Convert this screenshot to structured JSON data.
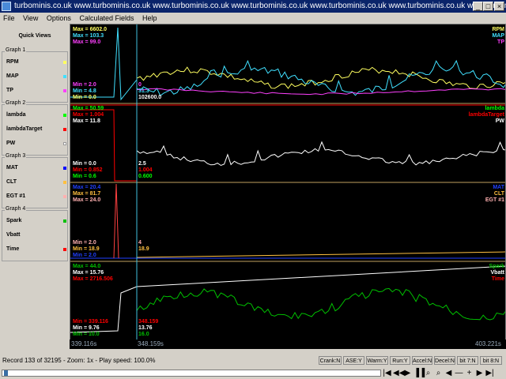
{
  "window": {
    "title": "turbominis.co.uk www.turbominis.co.uk www.turbominis.co.uk www.turbominis.co.uk www.turbominis.co.uk www.turbominis.co.uk www.turbominis.co.uk www.turbominis.co.uk",
    "minimize": "_",
    "maximize": "□",
    "close": "×"
  },
  "menu": [
    "File",
    "View",
    "Options",
    "Calculated Fields",
    "Help"
  ],
  "sidebar": {
    "heading": "Quick Views",
    "groups": [
      {
        "title": "Graph 1",
        "fields": [
          {
            "label": "RPM",
            "color": "#ffff60"
          },
          {
            "label": "MAP",
            "color": "#40e0ff"
          },
          {
            "label": "TP",
            "color": "#ff40ff"
          }
        ]
      },
      {
        "title": "Graph 2",
        "fields": [
          {
            "label": "lambda",
            "color": "#00ff00"
          },
          {
            "label": "lambdaTarget",
            "color": "#ff0000"
          },
          {
            "label": "PW",
            "color": "#ffffff"
          }
        ]
      },
      {
        "title": "Graph 3",
        "fields": [
          {
            "label": "MAT",
            "color": "#0000ff"
          },
          {
            "label": "CLT",
            "color": "#ffc040"
          },
          {
            "label": "EGT #1",
            "color": "#ffb0b0"
          }
        ]
      },
      {
        "title": "Graph 4",
        "fields": [
          {
            "label": "Spark",
            "color": "#00c000"
          },
          {
            "label": "Vbatt",
            "color": "#ffffff"
          },
          {
            "label": "Time",
            "color": "#ff0000"
          }
        ]
      }
    ]
  },
  "graphs": [
    {
      "max": [
        {
          "text": "Max = 6602.0",
          "color": "#ffff60"
        },
        {
          "text": "Max = 103.3",
          "color": "#40e0ff"
        },
        {
          "text": "Max = 99.0",
          "color": "#ff40ff"
        }
      ],
      "min": [
        {
          "text": "Min = 2.0",
          "color": "#ff40ff"
        },
        {
          "text": "Min = 4.8",
          "color": "#40e0ff"
        },
        {
          "text": "Min = 0.0",
          "color": "#ffff60"
        }
      ],
      "cursor": [
        {
          "text": "0",
          "color": "#ff40ff"
        },
        {
          "text": "31.3",
          "color": "#40e0ff"
        },
        {
          "text": "102600.0",
          "color": "#ffffff"
        }
      ],
      "legend": [
        {
          "text": "RPM",
          "color": "#ffff60"
        },
        {
          "text": "MAP",
          "color": "#40e0ff"
        },
        {
          "text": "TP",
          "color": "#ff40ff"
        }
      ]
    },
    {
      "max": [
        {
          "text": "Max = 50.59",
          "color": "#00ff00"
        },
        {
          "text": "Max = 1.004",
          "color": "#ff0000"
        },
        {
          "text": "Max = 11.8",
          "color": "#ffffff"
        }
      ],
      "min": [
        {
          "text": "Min = 0.0",
          "color": "#ffffff"
        },
        {
          "text": "Min = 0.852",
          "color": "#ff0000"
        },
        {
          "text": "Min = 0.6",
          "color": "#00ff00"
        }
      ],
      "cursor": [
        {
          "text": "2.5",
          "color": "#ffffff"
        },
        {
          "text": "1.004",
          "color": "#ff0000"
        },
        {
          "text": "0.600",
          "color": "#00ff00"
        }
      ],
      "legend": [
        {
          "text": "lambda",
          "color": "#00ff00"
        },
        {
          "text": "lambdaTarget",
          "color": "#ff0000"
        },
        {
          "text": "PW",
          "color": "#ffffff"
        }
      ]
    },
    {
      "max": [
        {
          "text": "Max = 20.4",
          "color": "#2040ff"
        },
        {
          "text": "Max = 81.7",
          "color": "#ffc040"
        },
        {
          "text": "Max = 24.0",
          "color": "#ffb0b0"
        }
      ],
      "min": [
        {
          "text": "Min = 2.0",
          "color": "#ffb0b0"
        },
        {
          "text": "Min = 18.9",
          "color": "#ffc040"
        },
        {
          "text": "Min = 2.0",
          "color": "#2040ff"
        }
      ],
      "cursor": [
        {
          "text": "4",
          "color": "#ffb0b0"
        },
        {
          "text": "18.9",
          "color": "#ffc040"
        }
      ],
      "legend": [
        {
          "text": "MAT",
          "color": "#2040ff"
        },
        {
          "text": "CLT",
          "color": "#ffc040"
        },
        {
          "text": "EGT #1",
          "color": "#ffb0b0"
        }
      ]
    },
    {
      "max": [
        {
          "text": "Max = 44.0",
          "color": "#00c000"
        },
        {
          "text": "Max = 15.76",
          "color": "#ffffff"
        },
        {
          "text": "Max = 2716.506",
          "color": "#ff0000"
        }
      ],
      "min": [
        {
          "text": "Min = 339.116",
          "color": "#ff0000"
        },
        {
          "text": "Min = 9.76",
          "color": "#ffffff"
        },
        {
          "text": "Min = 10.0",
          "color": "#00c000"
        }
      ],
      "cursor": [
        {
          "text": "348.159",
          "color": "#ff0000"
        },
        {
          "text": "13.76",
          "color": "#ffffff"
        },
        {
          "text": "16.0",
          "color": "#00c000"
        }
      ],
      "legend": [
        {
          "text": "Spark",
          "color": "#00c000"
        },
        {
          "text": "Vbatt",
          "color": "#ffffff"
        },
        {
          "text": "Time",
          "color": "#ff0000"
        }
      ]
    }
  ],
  "timeaxis": {
    "start": "339.116s",
    "cursor": "348.159s",
    "end": "403.221s"
  },
  "status": {
    "text": "Record 133 of 32195 - Zoom: 1x - Play speed: 100.0%",
    "indicators": [
      {
        "label": "Crank:N",
        "bg": "#40d040"
      },
      {
        "label": "ASE:Y",
        "bg": "#ff5050"
      },
      {
        "label": "Warm:Y",
        "bg": "#ff5050"
      },
      {
        "label": "Run:Y",
        "bg": "#ff5050"
      },
      {
        "label": "Accel:N",
        "bg": "#40d040"
      },
      {
        "label": "Decel:N",
        "bg": "#40d040"
      },
      {
        "label": "bit 7:N",
        "bg": "#40d040"
      },
      {
        "label": "bit 8:N",
        "bg": "#40d040"
      }
    ]
  },
  "controls": [
    "|◀",
    "◀◀",
    "▶",
    "▐▐",
    "⌕",
    "⌕",
    "◀",
    "—",
    "+",
    "▶",
    "▶|"
  ],
  "playback_position": 0.0041
}
